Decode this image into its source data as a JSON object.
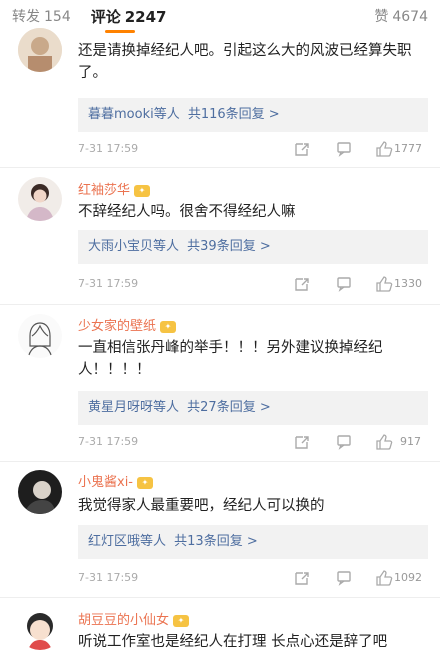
{
  "tabs": {
    "repost_label": "转发",
    "repost_count": "154",
    "comment_label": "评论",
    "comment_count": "2247",
    "like_label": "赞",
    "like_count": "4674"
  },
  "comments": [
    {
      "username": "",
      "text": "还是请换掉经纪人吧。引起这么大的风波已经算失职了。",
      "replies_by": "暮暮mooki等人",
      "replies_count": "共116条回复 >",
      "time": "7-31 17:59",
      "likes": "1777"
    },
    {
      "username": "红袖莎华",
      "text": "不辞经纪人吗。很舍不得经纪人嘛",
      "replies_by": "大雨小宝贝等人",
      "replies_count": "共39条回复 >",
      "time": "7-31 17:59",
      "likes": "1330"
    },
    {
      "username": "少女家的壁纸",
      "text": "一直相信张丹峰的举手！！！另外建议换掉经纪人！！！！",
      "replies_by": "黄星月呀呀等人",
      "replies_count": "共27条回复 >",
      "time": "7-31 17:59",
      "likes": "917"
    },
    {
      "username": "小鬼酱xi-",
      "text": "我觉得家人最重要吧，经纪人可以换的",
      "replies_by": "红灯区哦等人",
      "replies_count": "共13条回复 >",
      "time": "7-31 17:59",
      "likes": "1092"
    },
    {
      "username": "胡豆豆的小仙女",
      "text": "听说工作室也是经纪人在打理 长点心还是辞了吧",
      "replies_by": "",
      "replies_count": "",
      "time": "",
      "likes": ""
    }
  ],
  "icons": {
    "share": "share-icon",
    "comment": "comment-icon",
    "like": "thumbs-up-icon"
  },
  "colors": {
    "username": "#eb7350",
    "reply_link": "#4e6ea0",
    "tab_accent": "#ff8200"
  }
}
